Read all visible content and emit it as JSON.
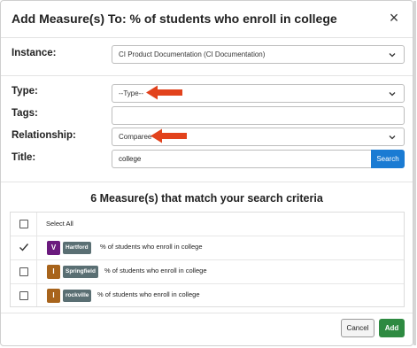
{
  "dialog": {
    "title": "Add Measure(s) To: % of students who enroll in college",
    "close_glyph": "×"
  },
  "form": {
    "instance": {
      "label": "Instance:",
      "value": "CI Product Documentation (CI Documentation)"
    },
    "type": {
      "label": "Type:",
      "value": "--Type--"
    },
    "tags": {
      "label": "Tags:",
      "value": ""
    },
    "relationship": {
      "label": "Relationship:",
      "value": "Comparee"
    },
    "title": {
      "label": "Title:",
      "value": "college"
    },
    "search_button": "Search"
  },
  "results": {
    "heading": "6 Measure(s) that match your search criteria",
    "select_all_label": "Select All",
    "rows": [
      {
        "badge_letter": "V",
        "badge_color": "#6b1a7e",
        "city": "Hartford",
        "text": "% of students who enroll in college",
        "checked": true
      },
      {
        "badge_letter": "I",
        "badge_color": "#a8641c",
        "city": "Springfield",
        "text": "% of students who enroll in college",
        "checked": false
      },
      {
        "badge_letter": "I",
        "badge_color": "#a8641c",
        "city": "rockville",
        "text": "% of students who enroll in college",
        "checked": false
      }
    ]
  },
  "footer": {
    "cancel_label": "Cancel",
    "add_label": "Add"
  },
  "colors": {
    "primary": "#1a7bd3",
    "add_green": "#2e8a41",
    "annotation_arrow": "#e2421c"
  }
}
